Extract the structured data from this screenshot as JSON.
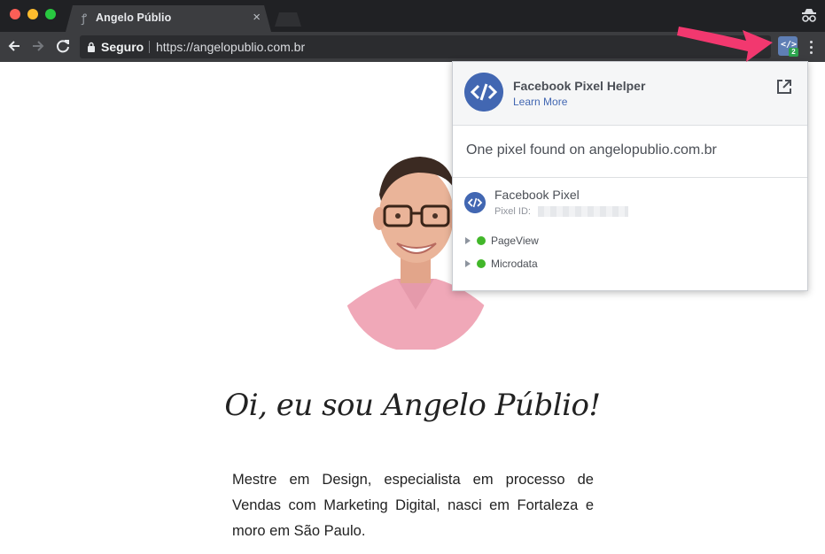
{
  "browser": {
    "tab": {
      "title": "Angelo Públio",
      "close_label": "×"
    },
    "omnibox": {
      "secure_label": "Seguro",
      "url": "https://angelopublio.com.br"
    },
    "extension": {
      "badge": "2",
      "glyph": "</>"
    }
  },
  "page": {
    "hero_title": "Oi, eu sou Angelo Públio!",
    "hero_text": "Mestre em Design, especialista em processo de Vendas com Marketing Digital, nasci em Fortaleza e moro em São Paulo."
  },
  "popup": {
    "title": "Facebook Pixel Helper",
    "learn_more": "Learn More",
    "summary": "One pixel found on angelopublio.com.br",
    "pixel": {
      "name": "Facebook Pixel",
      "id_label": "Pixel ID:",
      "events": [
        {
          "label": "PageView",
          "status": "ok"
        },
        {
          "label": "Microdata",
          "status": "ok"
        }
      ]
    }
  },
  "colors": {
    "facebook_blue": "#4267b2",
    "success_green": "#42b72a",
    "annotation_arrow": "#f2386f"
  },
  "icons": [
    "back-icon",
    "forward-icon",
    "reload-icon",
    "lock-icon",
    "star-icon",
    "pixel-helper-icon",
    "menu-icon",
    "incognito-icon",
    "open-external-icon",
    "check-icon",
    "caret-right-icon"
  ]
}
